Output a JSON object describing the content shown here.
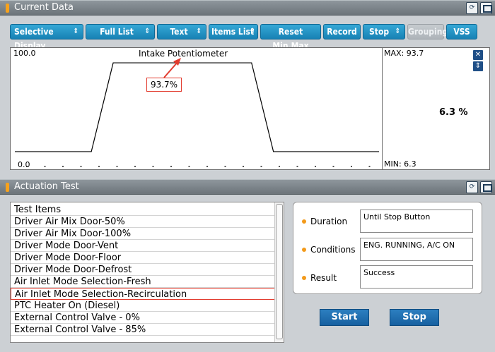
{
  "current_data": {
    "title": "Current Data",
    "retry_label": "Retry",
    "toolbar": [
      {
        "label": "Selective Display",
        "has_arrow": true
      },
      {
        "label": "Full List",
        "has_arrow": true
      },
      {
        "label": "Text",
        "has_arrow": true
      },
      {
        "label": "Items List",
        "has_arrow": true
      },
      {
        "label": "Reset Min.Max",
        "has_arrow": false
      },
      {
        "label": "Record",
        "has_arrow": false
      },
      {
        "label": "Stop",
        "has_arrow": true
      },
      {
        "label": "Grouping",
        "has_arrow": false,
        "disabled": true
      },
      {
        "label": "VSS",
        "has_arrow": false
      }
    ],
    "graph": {
      "y_max_label": "100.0",
      "y_min_label": "0.0",
      "series_label": "Intake Potentiometer",
      "callout": "93.7%",
      "max_text": "MAX: 93.7",
      "min_text": "MIN: 6.3",
      "current_value": "6.3 %"
    }
  },
  "chart_data": {
    "type": "line",
    "title": "Intake Potentiometer",
    "ylim": [
      0,
      100
    ],
    "x": [
      0,
      21,
      27,
      65,
      71,
      100
    ],
    "series": [
      {
        "name": "Intake Potentiometer",
        "values": [
          6.3,
          6.3,
          93.7,
          93.7,
          6.3,
          6.3
        ]
      }
    ],
    "y_tick_labels": [
      "100.0",
      "0.0"
    ],
    "annotations": [
      "93.7%",
      "MAX: 93.7",
      "MIN: 6.3"
    ]
  },
  "actuation_test": {
    "title": "Actuation Test",
    "retry_label": "Retry",
    "list_header": "Test Items",
    "items": [
      "Driver Air Mix Door-50%",
      "Driver Air Mix Door-100%",
      "Driver Mode Door-Vent",
      "Driver Mode Door-Floor",
      "Driver Mode Door-Defrost",
      "Air Inlet Mode Selection-Fresh",
      "Air Inlet Mode Selection-Recirculation",
      "PTC Heater On (Diesel)",
      "External Control Valve - 0%",
      "External Control Valve - 85%"
    ],
    "selected_index": 6,
    "info": {
      "duration_label": "Duration",
      "duration_value": "Until Stop Button",
      "conditions_label": "Conditions",
      "conditions_value": "ENG. RUNNING, A/C ON",
      "result_label": "Result",
      "result_value": "Success"
    },
    "start_label": "Start",
    "stop_label": "Stop"
  },
  "colors": {
    "button_blue": "#1e8fc4",
    "selection_border": "#e23b2e",
    "accent_orange": "#f39a1a"
  }
}
